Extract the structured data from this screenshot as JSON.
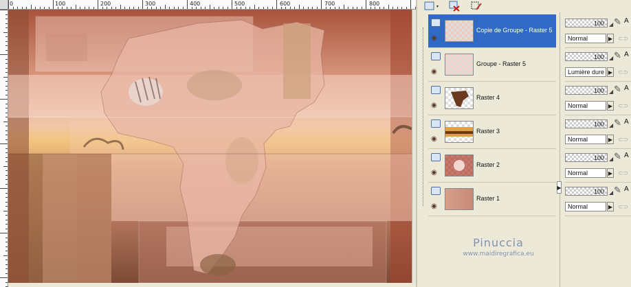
{
  "ruler": {
    "top_labels": [
      "0",
      "100",
      "200",
      "300",
      "400",
      "500",
      "600",
      "700",
      "800"
    ]
  },
  "layers": [
    {
      "name": "Copie de Groupe - Raster 5",
      "selected": true,
      "opacity": "100",
      "blend": "Normal"
    },
    {
      "name": "Groupe - Raster 5",
      "selected": false,
      "opacity": "100",
      "blend": "Lumière dure"
    },
    {
      "name": "Raster 4",
      "selected": false,
      "opacity": "100",
      "blend": "Normal"
    },
    {
      "name": "Raster 3",
      "selected": false,
      "opacity": "100",
      "blend": "Normal"
    },
    {
      "name": "Raster 2",
      "selected": false,
      "opacity": "100",
      "blend": "Normal"
    },
    {
      "name": "Raster 1",
      "selected": false,
      "opacity": "100",
      "blend": "Normal"
    }
  ],
  "prop_letter": "A",
  "watermark": {
    "name": "Pinuccia",
    "url": "www.maidiregrafica.eu"
  },
  "icons": {
    "new_layer": "new-raster-layer-icon",
    "delete_layer": "delete-layer-icon",
    "edit": "edit-selection-icon",
    "visibility": "eye-icon",
    "link": "layer-group-icon"
  }
}
